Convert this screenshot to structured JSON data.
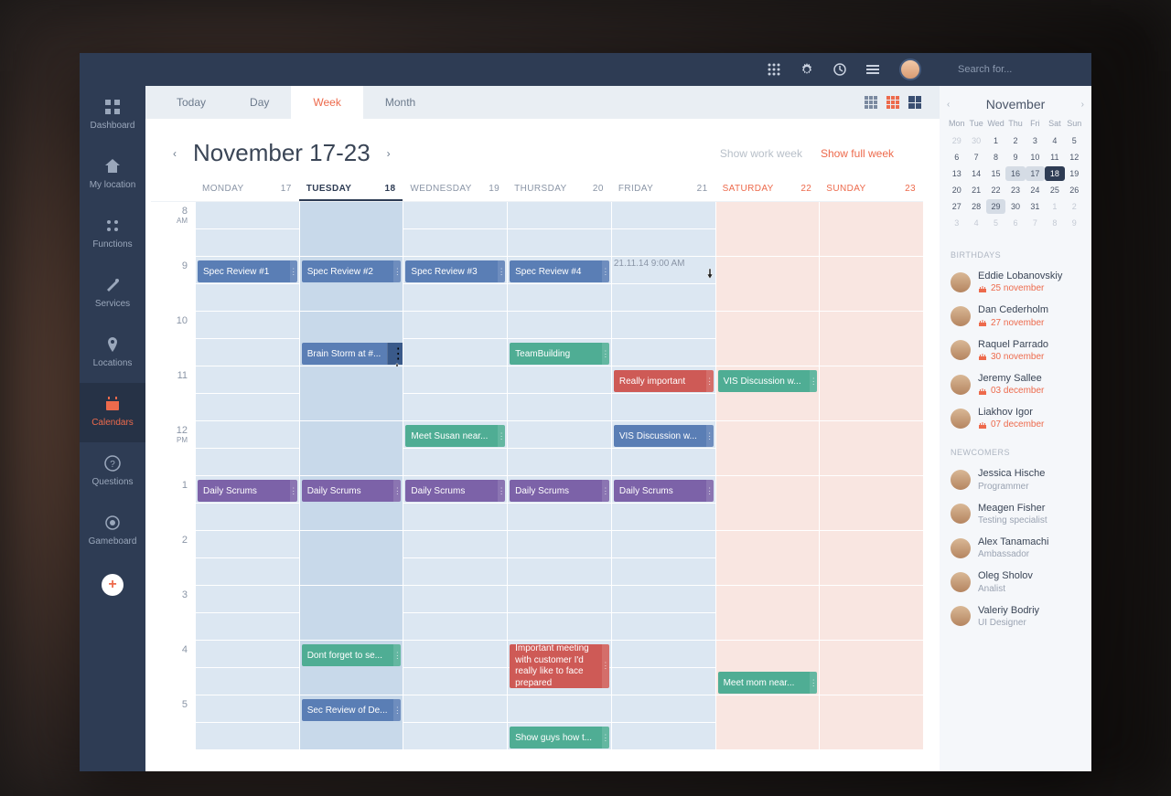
{
  "search": {
    "placeholder": "Search for..."
  },
  "sidebar": {
    "items": [
      {
        "label": "Dashboard"
      },
      {
        "label": "My location"
      },
      {
        "label": "Functions"
      },
      {
        "label": "Services"
      },
      {
        "label": "Locations"
      },
      {
        "label": "Calendars"
      },
      {
        "label": "Questions"
      },
      {
        "label": "Gameboard"
      }
    ]
  },
  "tabs": {
    "today": "Today",
    "day": "Day",
    "week": "Week",
    "month": "Month"
  },
  "title": "November 17-23",
  "workweek": {
    "show": "Show work week",
    "full": "Show full week"
  },
  "days": [
    {
      "name": "MONDAY",
      "num": "17"
    },
    {
      "name": "TUESDAY",
      "num": "18"
    },
    {
      "name": "WEDNESDAY",
      "num": "19"
    },
    {
      "name": "THURSDAY",
      "num": "20"
    },
    {
      "name": "FRIDAY",
      "num": "21"
    },
    {
      "name": "SATURDAY",
      "num": "22"
    },
    {
      "name": "SUNDAY",
      "num": "23"
    }
  ],
  "hours": [
    {
      "n": "8",
      "p": "AM"
    },
    {
      "n": "9"
    },
    {
      "n": "10"
    },
    {
      "n": "11"
    },
    {
      "n": "12",
      "p": "PM"
    },
    {
      "n": "1"
    },
    {
      "n": "2"
    },
    {
      "n": "3"
    },
    {
      "n": "4"
    },
    {
      "n": "5"
    }
  ],
  "ghost": "21.11.14   9:00 AM",
  "events": {
    "r1c0": "Spec Review #1",
    "r1c1": "Spec Review #2",
    "r1c2": "Spec Review #3",
    "r1c3": "Spec Review #4",
    "bs": "Brain Storm at #...",
    "tb": "TeamBuilding",
    "ri": "Really important",
    "vis1": "VIS Discussion w...",
    "susan": "Meet Susan near...",
    "vis2": "VIS Discussion w...",
    "ds": "Daily Scrums",
    "forget": "Dont forget to se...",
    "im": "Important meeting with customer I'd really like to face prepared",
    "mom": "Meet mom near...",
    "sec": "Sec Review of De...",
    "show": "Show guys how t..."
  },
  "mini": {
    "month": "November",
    "dow": [
      "Mon",
      "Tue",
      "Wed",
      "Thu",
      "Fri",
      "Sat",
      "Sun"
    ],
    "rows": [
      [
        {
          "n": "29",
          "dim": 1
        },
        {
          "n": "30",
          "dim": 1
        },
        {
          "n": "1"
        },
        {
          "n": "2"
        },
        {
          "n": "3"
        },
        {
          "n": "4"
        },
        {
          "n": "5"
        }
      ],
      [
        {
          "n": "6"
        },
        {
          "n": "7"
        },
        {
          "n": "8"
        },
        {
          "n": "9"
        },
        {
          "n": "10"
        },
        {
          "n": "11"
        },
        {
          "n": "12"
        }
      ],
      [
        {
          "n": "13"
        },
        {
          "n": "14"
        },
        {
          "n": "15"
        },
        {
          "n": "16",
          "hl": 1
        },
        {
          "n": "17",
          "hl": 1
        },
        {
          "n": "18",
          "cur": 1
        },
        {
          "n": "19"
        }
      ],
      [
        {
          "n": "20"
        },
        {
          "n": "21"
        },
        {
          "n": "22"
        },
        {
          "n": "23"
        },
        {
          "n": "24"
        },
        {
          "n": "25"
        },
        {
          "n": "26"
        }
      ],
      [
        {
          "n": "27"
        },
        {
          "n": "28"
        },
        {
          "n": "29",
          "hl": 1
        },
        {
          "n": "30"
        },
        {
          "n": "31"
        },
        {
          "n": "1",
          "dim": 1
        },
        {
          "n": "2",
          "dim": 1
        }
      ],
      [
        {
          "n": "3",
          "dim": 1
        },
        {
          "n": "4",
          "dim": 1
        },
        {
          "n": "5",
          "dim": 1
        },
        {
          "n": "6",
          "dim": 1
        },
        {
          "n": "7",
          "dim": 1
        },
        {
          "n": "8",
          "dim": 1
        },
        {
          "n": "9",
          "dim": 1
        }
      ]
    ]
  },
  "sections": {
    "birthdays": "BIRTHDAYS",
    "newcomers": "NEWCOMERS"
  },
  "birthdays": [
    {
      "name": "Eddie Lobanovskiy",
      "date": "25 november"
    },
    {
      "name": "Dan Cederholm",
      "date": "27 november"
    },
    {
      "name": "Raquel Parrado",
      "date": "30 november"
    },
    {
      "name": "Jeremy Sallee",
      "date": "03 december"
    },
    {
      "name": "Liakhov Igor",
      "date": "07 december"
    }
  ],
  "newcomers": [
    {
      "name": "Jessica Hische",
      "role": "Programmer"
    },
    {
      "name": "Meagen Fisher",
      "role": "Testing specialist"
    },
    {
      "name": "Alex Tanamachi",
      "role": "Ambassador"
    },
    {
      "name": "Oleg Sholov",
      "role": "Analist"
    },
    {
      "name": "Valeriy Bodriy",
      "role": "UI Designer"
    }
  ]
}
